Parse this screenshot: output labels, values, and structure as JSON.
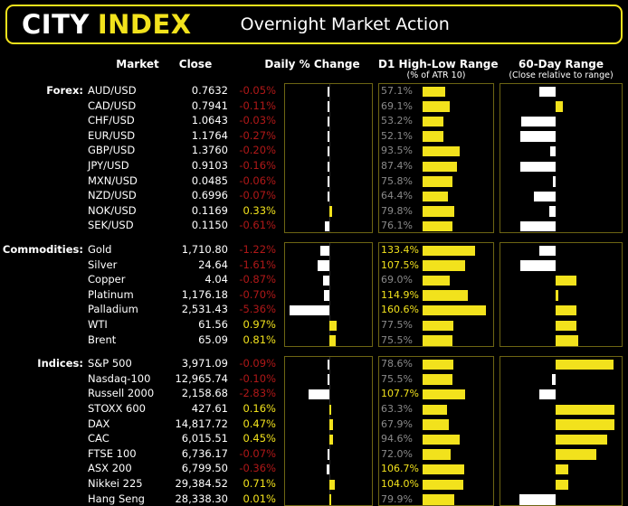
{
  "banner": {
    "brand_primary": "CITY",
    "brand_secondary": "INDEX",
    "title": "Overnight Market Action",
    "border_color": "#f2e21c"
  },
  "columns": {
    "market": "Market",
    "close": "Close",
    "daily_change": "Daily % Change",
    "d1_range": "D1 High-Low Range",
    "d1_range_sub": "(% of ATR 10)",
    "sixty_day": "60-Day Range",
    "sixty_day_sub": "(Close relative to range)"
  },
  "colors": {
    "positive": "#f2e21c",
    "negative": "#b01818",
    "bar_positive": "#f2e21c",
    "bar_negative": "#ffffff",
    "atr_low": "#8a8a8a",
    "atr_high": "#f2e21c",
    "panel_border": "#6d6513",
    "background": "#000000"
  },
  "chart_data": {
    "type": "bar",
    "title": "Overnight Market Action",
    "layout": "grouped horizontal diverging bars, three panels per row",
    "panels": [
      {
        "name": "Daily % Change",
        "type": "diverging-bar",
        "unit": "percent",
        "xlim": [
          -6.0,
          6.0
        ],
        "zero_at": 0.5
      },
      {
        "name": "D1 High-Low Range",
        "type": "bar",
        "unit": "percent of ATR 10",
        "xlim": [
          0,
          175
        ]
      },
      {
        "name": "60-Day Range",
        "type": "diverging-bar",
        "unit": "close relative to range",
        "xlim": [
          -1,
          1
        ],
        "zero_at": 0.45
      }
    ],
    "groups": [
      {
        "name": "Forex:",
        "rows": [
          {
            "market": "AUD/USD",
            "close": "0.7632",
            "change": "-0.05%",
            "change_value": -0.05,
            "atr": "57.1%",
            "atr_value": 57.1,
            "range_value": -0.3
          },
          {
            "market": "CAD/USD",
            "close": "0.7941",
            "change": "-0.11%",
            "change_value": -0.11,
            "atr": "69.1%",
            "atr_value": 69.1,
            "range_value": 0.1
          },
          {
            "market": "CHF/USD",
            "close": "1.0643",
            "change": "-0.03%",
            "change_value": -0.03,
            "atr": "53.2%",
            "atr_value": 53.2,
            "range_value": -0.62
          },
          {
            "market": "EUR/USD",
            "close": "1.1764",
            "change": "-0.27%",
            "change_value": -0.27,
            "atr": "52.1%",
            "atr_value": 52.1,
            "range_value": -0.64
          },
          {
            "market": "GBP/USD",
            "close": "1.3760",
            "change": "-0.20%",
            "change_value": -0.2,
            "atr": "93.5%",
            "atr_value": 93.5,
            "range_value": -0.1
          },
          {
            "market": "JPY/USD",
            "close": "0.9103",
            "change": "-0.16%",
            "change_value": -0.16,
            "atr": "87.4%",
            "atr_value": 87.4,
            "range_value": -0.64
          },
          {
            "market": "MXN/USD",
            "close": "0.0485",
            "change": "-0.06%",
            "change_value": -0.06,
            "atr": "75.8%",
            "atr_value": 75.8,
            "range_value": -0.04
          },
          {
            "market": "NZD/USD",
            "close": "0.6996",
            "change": "-0.07%",
            "change_value": -0.07,
            "atr": "64.4%",
            "atr_value": 64.4,
            "range_value": -0.39
          },
          {
            "market": "NOK/USD",
            "close": "0.1169",
            "change": "0.33%",
            "change_value": 0.33,
            "atr": "79.8%",
            "atr_value": 79.8,
            "range_value": -0.11
          },
          {
            "market": "SEK/USD",
            "close": "0.1150",
            "change": "-0.61%",
            "change_value": -0.61,
            "atr": "76.1%",
            "atr_value": 76.1,
            "range_value": -0.64
          }
        ]
      },
      {
        "name": "Commodities:",
        "rows": [
          {
            "market": "Gold",
            "close": "1,710.80",
            "change": "-1.22%",
            "change_value": -1.22,
            "atr": "133.4%",
            "atr_value": 133.4,
            "range_value": -0.3
          },
          {
            "market": "Silver",
            "close": "24.64",
            "change": "-1.61%",
            "change_value": -1.61,
            "atr": "107.5%",
            "atr_value": 107.5,
            "range_value": -0.64
          },
          {
            "market": "Copper",
            "close": "4.04",
            "change": "-0.87%",
            "change_value": -0.87,
            "atr": "69.0%",
            "atr_value": 69.0,
            "range_value": 0.31
          },
          {
            "market": "Platinum",
            "close": "1,176.18",
            "change": "-0.70%",
            "change_value": -0.7,
            "atr": "114.9%",
            "atr_value": 114.9,
            "range_value": 0.02
          },
          {
            "market": "Palladium",
            "close": "2,531.43",
            "change": "-5.36%",
            "change_value": -5.36,
            "atr": "160.6%",
            "atr_value": 160.6,
            "range_value": 0.31
          },
          {
            "market": "WTI",
            "close": "61.56",
            "change": "0.97%",
            "change_value": 0.97,
            "atr": "77.5%",
            "atr_value": 77.5,
            "range_value": 0.31
          },
          {
            "market": "Brent",
            "close": "65.09",
            "change": "0.81%",
            "change_value": 0.81,
            "atr": "75.5%",
            "atr_value": 75.5,
            "range_value": 0.33
          }
        ]
      },
      {
        "name": "Indices:",
        "rows": [
          {
            "market": "S&P 500",
            "close": "3,971.09",
            "change": "-0.09%",
            "change_value": -0.09,
            "atr": "78.6%",
            "atr_value": 78.6,
            "range_value": 0.85
          },
          {
            "market": "Nasdaq-100",
            "close": "12,965.74",
            "change": "-0.10%",
            "change_value": -0.1,
            "atr": "75.5%",
            "atr_value": 75.5,
            "range_value": -0.07
          },
          {
            "market": "Russell 2000",
            "close": "2,158.68",
            "change": "-2.83%",
            "change_value": -2.83,
            "atr": "107.7%",
            "atr_value": 107.7,
            "range_value": -0.3
          },
          {
            "market": "STOXX 600",
            "close": "427.61",
            "change": "0.16%",
            "change_value": 0.16,
            "atr": "63.3%",
            "atr_value": 63.3,
            "range_value": 0.86
          },
          {
            "market": "DAX",
            "close": "14,817.72",
            "change": "0.47%",
            "change_value": 0.47,
            "atr": "67.9%",
            "atr_value": 67.9,
            "range_value": 0.86
          },
          {
            "market": "CAC",
            "close": "6,015.51",
            "change": "0.45%",
            "change_value": 0.45,
            "atr": "94.6%",
            "atr_value": 94.6,
            "range_value": 0.76
          },
          {
            "market": "FTSE 100",
            "close": "6,736.17",
            "change": "-0.07%",
            "change_value": -0.07,
            "atr": "72.0%",
            "atr_value": 72.0,
            "range_value": 0.6
          },
          {
            "market": "ASX 200",
            "close": "6,799.50",
            "change": "-0.36%",
            "change_value": -0.36,
            "atr": "106.7%",
            "atr_value": 106.7,
            "range_value": 0.18
          },
          {
            "market": "Nikkei 225",
            "close": "29,384.52",
            "change": "0.71%",
            "change_value": 0.71,
            "atr": "104.0%",
            "atr_value": 104.0,
            "range_value": 0.18
          },
          {
            "market": "Hang Seng",
            "close": "28,338.30",
            "change": "0.01%",
            "change_value": 0.01,
            "atr": "79.9%",
            "atr_value": 79.9,
            "range_value": -0.66
          }
        ]
      }
    ]
  }
}
